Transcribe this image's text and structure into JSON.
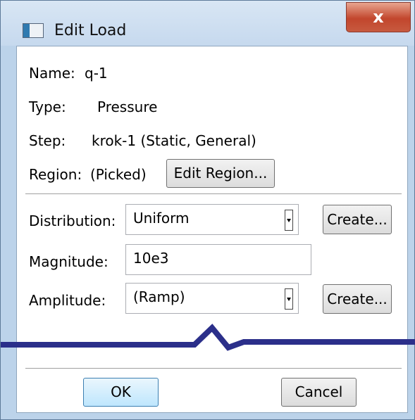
{
  "window": {
    "title": "Edit Load",
    "close_glyph": "x",
    "icon": "app-window-icon"
  },
  "info": {
    "name_label": "Name:",
    "name_value": "q-1",
    "type_label": "Type:",
    "type_value": "Pressure",
    "step_label": "Step:",
    "step_value": "krok-1 (Static, General)",
    "region_label": "Region:",
    "region_value": "(Picked)",
    "edit_region_button": "Edit Region..."
  },
  "form": {
    "distribution_label": "Distribution:",
    "distribution_value": "Uniform",
    "distribution_create": "Create...",
    "magnitude_label": "Magnitude:",
    "magnitude_value": "10e3",
    "amplitude_label": "Amplitude:",
    "amplitude_value": "(Ramp)",
    "amplitude_create": "Create..."
  },
  "buttons": {
    "ok": "OK",
    "cancel": "Cancel"
  },
  "colors": {
    "break_line": "#2b2f8a",
    "close_button": "#c2462d",
    "window_frame": "#bcd3ea"
  }
}
